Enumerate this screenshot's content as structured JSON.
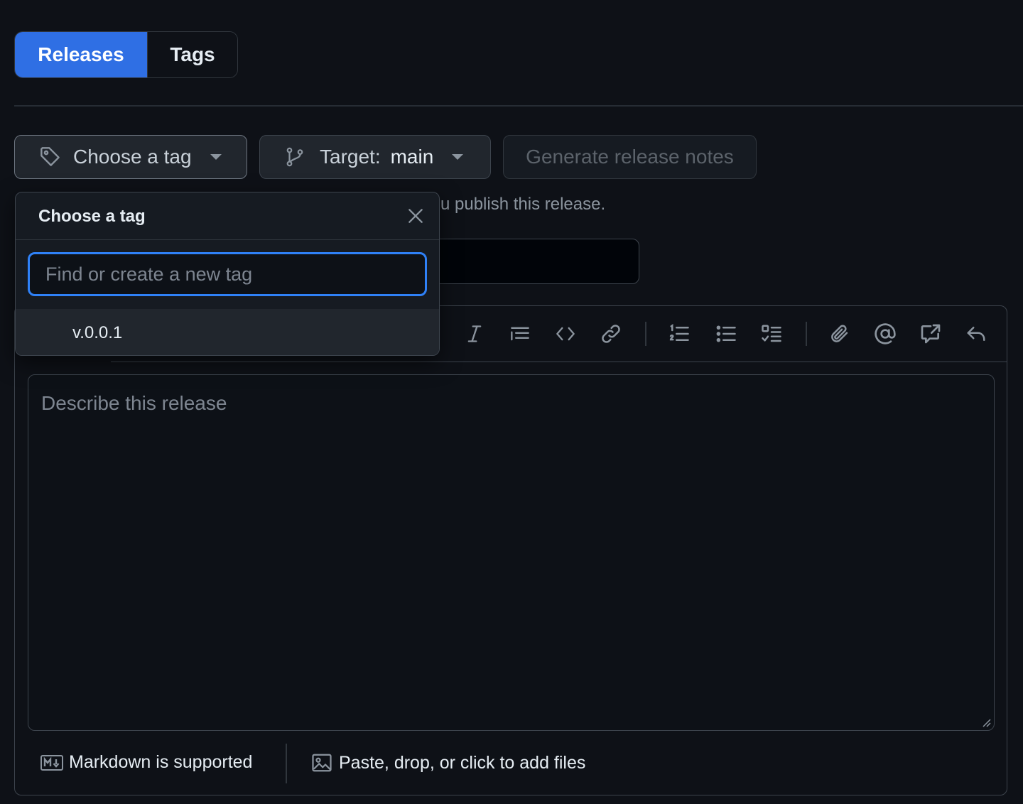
{
  "tabs": {
    "releases": "Releases",
    "tags": "Tags"
  },
  "toolbar": {
    "tag_button": "Choose a tag",
    "target_prefix": "Target:",
    "target_value": "main",
    "generate_notes": "Generate release notes"
  },
  "helper_text": "u publish this release.",
  "dropdown": {
    "title": "Choose a tag",
    "search_placeholder": "Find or create a new tag",
    "items": [
      "v.0.0.1"
    ]
  },
  "editor": {
    "placeholder": "Describe this release",
    "markdown_note": "Markdown is supported",
    "files_note": "Paste, drop, or click to add files"
  },
  "colors": {
    "accent": "#2f6fe4",
    "focus": "#2f81f7",
    "background": "#0e1117"
  }
}
